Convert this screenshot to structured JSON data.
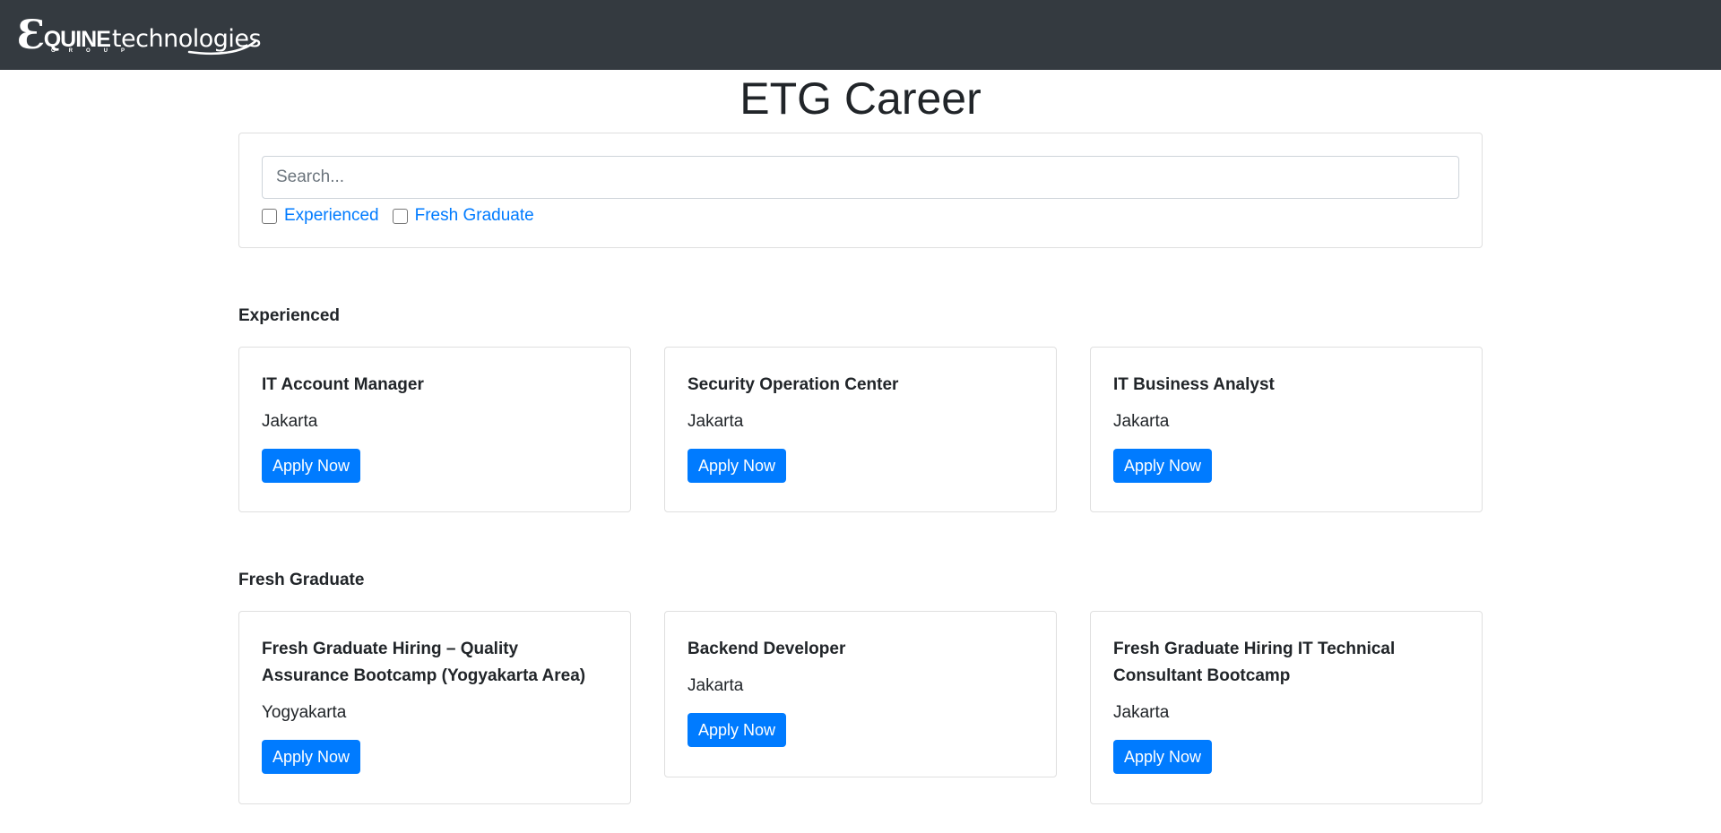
{
  "brand": {
    "logo_e": "Ɛ",
    "logo_quine": "QUINE",
    "logo_tech": "technologies",
    "logo_group": "GROUP"
  },
  "page": {
    "title": "ETG Career"
  },
  "filters": {
    "search_placeholder": "Search...",
    "search_value": "",
    "options": [
      {
        "label": "Experienced",
        "checked": false
      },
      {
        "label": "Fresh Graduate",
        "checked": false
      }
    ]
  },
  "sections": {
    "experienced": {
      "heading": "Experienced",
      "jobs": [
        {
          "title": "IT Account Manager",
          "location": "Jakarta",
          "button": "Apply Now"
        },
        {
          "title": "Security Operation Center",
          "location": "Jakarta",
          "button": "Apply Now"
        },
        {
          "title": "IT Business Analyst",
          "location": "Jakarta",
          "button": "Apply Now"
        }
      ]
    },
    "fresh": {
      "heading": "Fresh Graduate",
      "jobs": [
        {
          "title": "Fresh Graduate Hiring – Quality Assurance Bootcamp (Yogyakarta Area)",
          "location": "Yogyakarta",
          "button": "Apply Now"
        },
        {
          "title": "Backend Developer",
          "location": "Jakarta",
          "button": "Apply Now"
        },
        {
          "title": "Fresh Graduate Hiring IT Technical Consultant Bootcamp",
          "location": "Jakarta",
          "button": "Apply Now"
        }
      ]
    }
  },
  "colors": {
    "navbar": "#343a40",
    "accent": "#007bff",
    "border": "#dfdfdf"
  }
}
